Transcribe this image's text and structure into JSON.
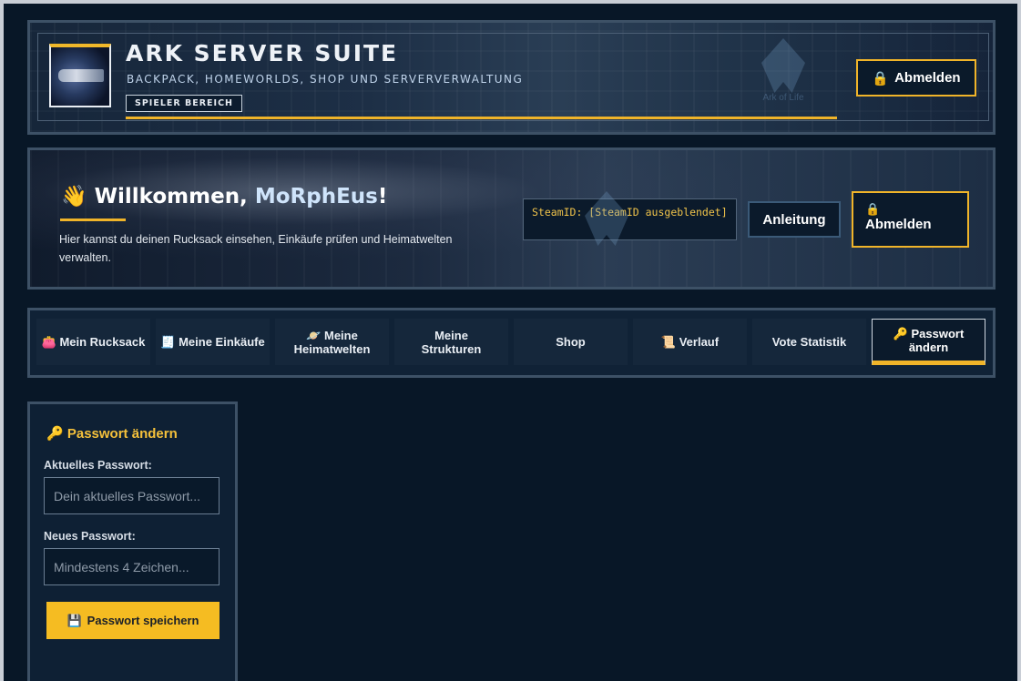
{
  "header": {
    "title": "ARK SERVER SUITE",
    "subtitle": "BACKPACK, HOMEWORLDS, SHOP UND SERVERVERWALTUNG",
    "area_badge": "SPIELER BEREICH",
    "emblem_text": "Ark of Life",
    "logout_label": "Abmelden",
    "logout_icon": "🔒"
  },
  "welcome": {
    "icon": "👋",
    "greeting": "Willkommen,",
    "username": "MoRphEus",
    "exclamation": "!",
    "text": "Hier kannst du deinen Rucksack einsehen, Einkäufe prüfen und Heimatwelten verwalten.",
    "steamid": "SteamID: [SteamID ausgeblendet]",
    "guide_label": "Anleitung",
    "logout_label": "Abmelden",
    "logout_icon": "🔒",
    "emblem_text": "Ark of Life"
  },
  "nav": {
    "tabs": [
      {
        "icon": "👛",
        "label": "Mein Rucksack"
      },
      {
        "icon": "🧾",
        "label": "Meine Einkäufe"
      },
      {
        "icon": "🪐",
        "label": "Meine Heimatwelten"
      },
      {
        "icon": "",
        "label": "Meine Strukturen"
      },
      {
        "icon": "",
        "label": "Shop"
      },
      {
        "icon": "📜",
        "label": "Verlauf"
      },
      {
        "icon": "",
        "label": "Vote Statistik"
      },
      {
        "icon": "🔑",
        "label": "Passwort ändern"
      }
    ],
    "active_index": 7
  },
  "password_card": {
    "icon": "🔑",
    "title": "Passwort ändern",
    "current_label": "Aktuelles Passwort:",
    "current_placeholder": "Dein aktuelles Passwort...",
    "new_label": "Neues Passwort:",
    "new_placeholder": "Mindestens 4 Zeichen...",
    "save_icon": "💾",
    "save_label": "Passwort speichern"
  },
  "colors": {
    "accent": "#f0b429",
    "background": "#081727",
    "panel": "#0e2034"
  }
}
